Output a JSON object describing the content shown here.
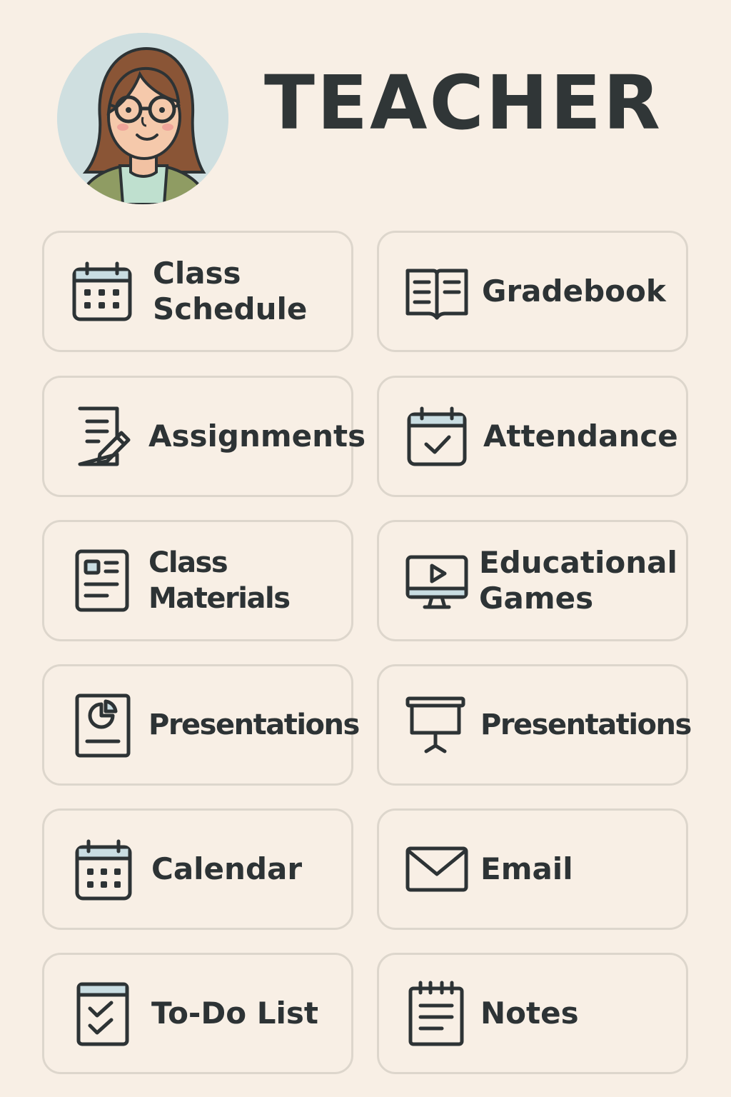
{
  "header": {
    "title": "TEACHER"
  },
  "avatar": {
    "icon": "teacher-avatar-icon"
  },
  "tiles": [
    {
      "label": "Class\nSchedule",
      "icon": "calendar-grid-icon"
    },
    {
      "label": "Gradebook",
      "icon": "open-book-icon"
    },
    {
      "label": "Assignments",
      "icon": "document-pencil-icon"
    },
    {
      "label": "Attendance",
      "icon": "calendar-check-icon"
    },
    {
      "label": "Class Materials",
      "icon": "document-image-icon"
    },
    {
      "label": "Educational\nGames",
      "icon": "monitor-play-icon"
    },
    {
      "label": "Presentations",
      "icon": "document-chart-icon"
    },
    {
      "label": "Presentations",
      "icon": "projector-screen-icon"
    },
    {
      "label": "Calendar",
      "icon": "calendar-grid-icon"
    },
    {
      "label": "Email",
      "icon": "envelope-icon"
    },
    {
      "label": "To-Do List",
      "icon": "checklist-icon"
    },
    {
      "label": "Notes",
      "icon": "notepad-icon"
    }
  ],
  "colors": {
    "background": "#f8efe5",
    "tile_border": "#ddd6cc",
    "text": "#2d3335",
    "icon_accent": "#c9dde2"
  }
}
